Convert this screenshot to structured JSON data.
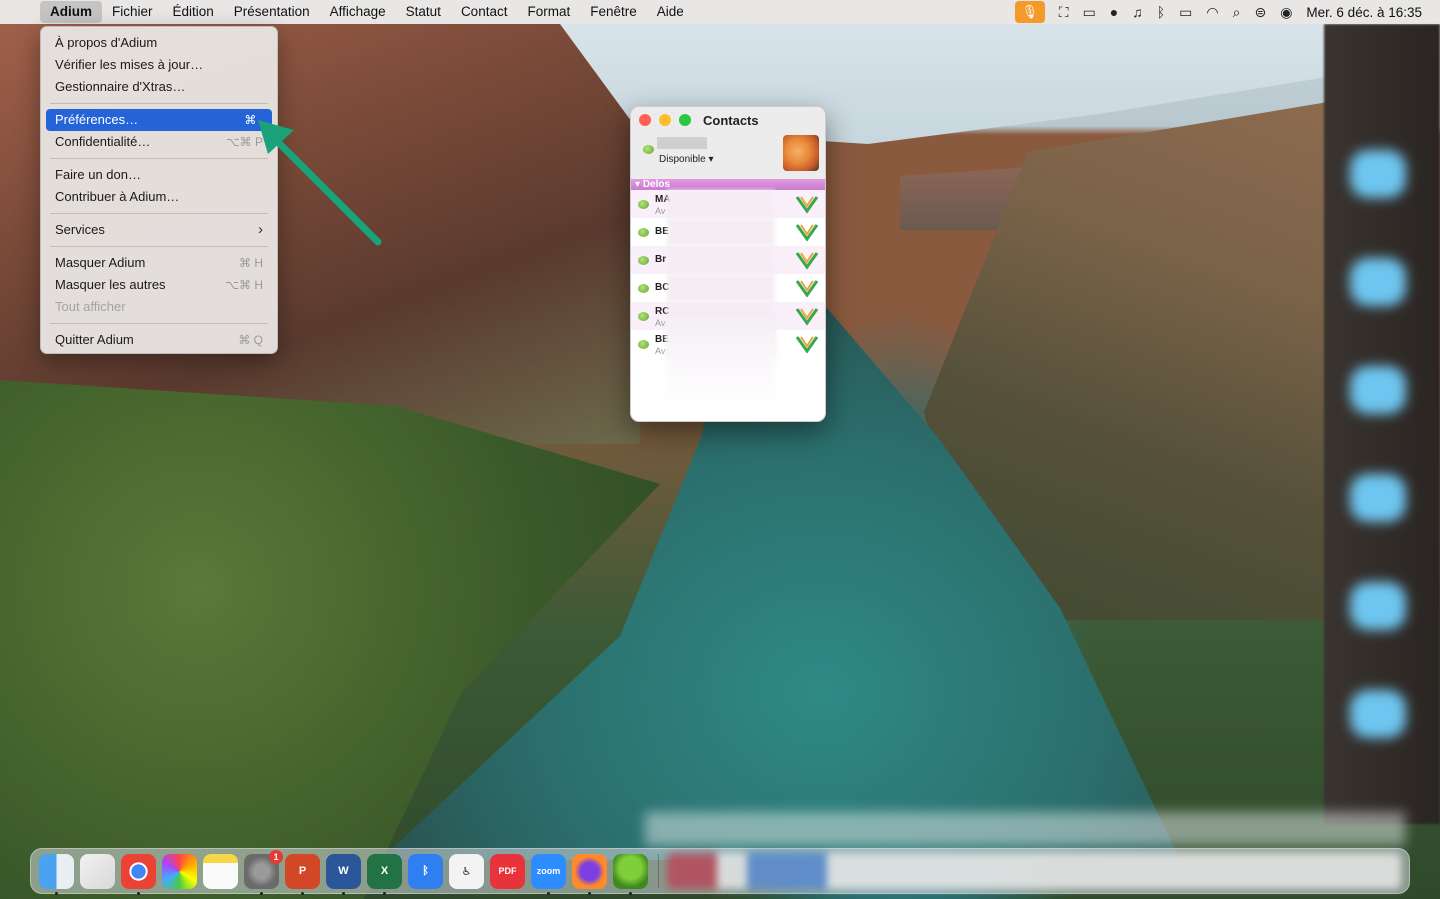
{
  "menubar": {
    "app_name": "Adium",
    "items": [
      "Fichier",
      "Édition",
      "Présentation",
      "Affichage",
      "Statut",
      "Contact",
      "Format",
      "Fenêtre",
      "Aide"
    ],
    "clock": "Mer. 6 déc. à 16:35"
  },
  "adium_menu": {
    "items": [
      {
        "label": "À propos d'Adium",
        "shortcut": ""
      },
      {
        "label": "Vérifier les mises à jour…",
        "shortcut": ""
      },
      {
        "label": "Gestionnaire d'Xtras…",
        "shortcut": ""
      },
      {
        "label": "Préférences…",
        "shortcut": "⌘ ,"
      },
      {
        "label": "Confidentialité…",
        "shortcut": "⌥⌘ P"
      },
      {
        "label": "Faire un don…",
        "shortcut": ""
      },
      {
        "label": "Contribuer à Adium…",
        "shortcut": ""
      },
      {
        "label": "Services",
        "shortcut": "›"
      },
      {
        "label": "Masquer Adium",
        "shortcut": "⌘ H"
      },
      {
        "label": "Masquer les autres",
        "shortcut": "⌥⌘ H"
      },
      {
        "label": "Tout afficher",
        "shortcut": ""
      },
      {
        "label": "Quitter Adium",
        "shortcut": "⌘ Q"
      }
    ]
  },
  "contacts_window": {
    "title": "Contacts",
    "status": "Disponible",
    "group": "Delos",
    "rows": [
      {
        "name": "MA",
        "status": "Av"
      },
      {
        "name": "BE",
        "status": ""
      },
      {
        "name": "Br",
        "status": ""
      },
      {
        "name": "BC",
        "status": ""
      },
      {
        "name": "RC",
        "status": "Av"
      },
      {
        "name": "BE",
        "status": "Av"
      }
    ]
  },
  "dock": {
    "zoom_label": "zoom",
    "pdf_label": "PDF",
    "settings_badge": "1"
  },
  "colors": {
    "selection": "#2563d9",
    "arrow": "#1aa37a",
    "mic": "#f39a2b"
  }
}
